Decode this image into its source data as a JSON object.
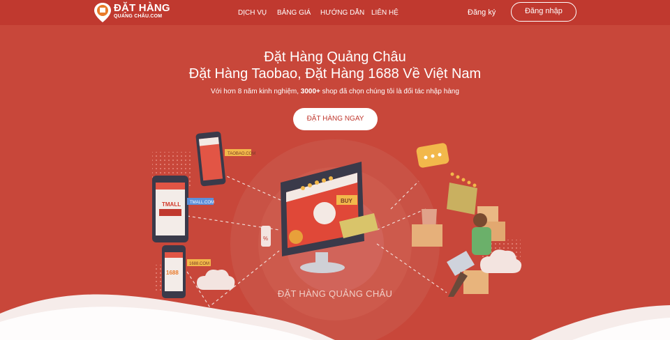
{
  "header": {
    "logo_name": "ĐẶT HÀNG",
    "logo_sub": "QUẢNG CHÂU.COM",
    "nav": [
      "DỊCH VỤ",
      "BẢNG GIÁ",
      "HƯỚNG DẪN",
      "LIÊN HỆ"
    ],
    "register_label": "Đăng ký",
    "login_label": "Đăng nhập"
  },
  "hero": {
    "title_line1": "Đặt Hàng Quảng Châu",
    "title_line2": "Đặt Hàng Taobao, Đặt Hàng 1688 Về Việt Nam",
    "desc_prefix": "Với hơn 8 năm kinh nghiệm, ",
    "desc_bold": "3000+",
    "desc_suffix": " shop đã chọn chúng tôi là đối tác nhập hàng",
    "cta_label": "ĐẶT HÀNG NGAY"
  },
  "illustration": {
    "tag_taobao": "TAOBAO.COM",
    "tag_tmall": "TMALL.COM",
    "tag_1688": "1688.COM",
    "tmall_screen": "TMALL",
    "screen_1688": "1688",
    "buy_tag": "BUY",
    "percent_tag": "%",
    "caption": "ĐẶT HÀNG QUẢNG CHÂU"
  },
  "colors": {
    "background": "#c8473a",
    "header": "#c0392f",
    "cta_text": "#c0392f",
    "accent_yellow": "#f2b84b",
    "dark": "#3a3a4a"
  }
}
